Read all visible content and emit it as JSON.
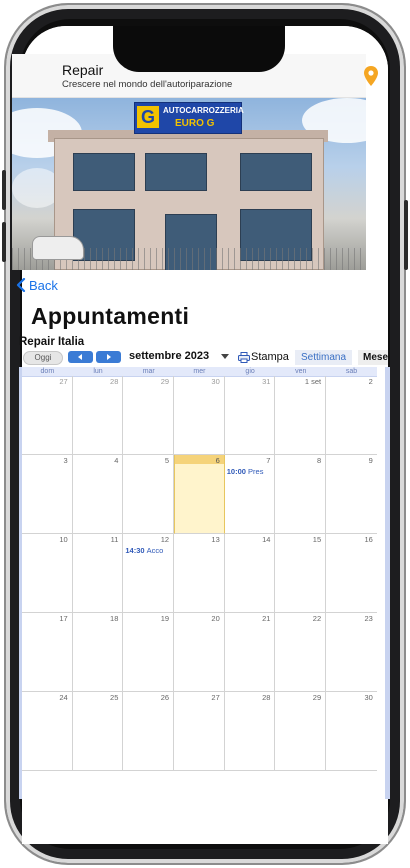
{
  "app": {
    "title": "Repair",
    "subtitle": "Crescere nel mondo dell'autoriparazione",
    "location_icon": "map-pin-icon",
    "accent_color": "#f5a623"
  },
  "banner": {
    "sign_line1": "AUTOCARROZZERIA",
    "sign_line2": "EURO G",
    "sign_logo": "G"
  },
  "nav": {
    "back_label": "Back",
    "back_icon": "chevron-left-icon",
    "page_title": "Appuntamenti"
  },
  "calendar": {
    "name": "Repair Italia",
    "today_label": "Oggi",
    "prev_icon": "arrow-left-icon",
    "next_icon": "arrow-right-icon",
    "month_label": "settembre 2023",
    "print_label": "Stampa",
    "print_icon": "printer-icon",
    "tab_week": "Settimana",
    "tab_month": "Mese",
    "weekdays": [
      "dom",
      "lun",
      "mar",
      "mer",
      "gio",
      "ven",
      "sab"
    ],
    "weeks": [
      [
        {
          "n": "27",
          "other": true
        },
        {
          "n": "28",
          "other": true
        },
        {
          "n": "29",
          "other": true
        },
        {
          "n": "30",
          "other": true
        },
        {
          "n": "31",
          "other": true
        },
        {
          "n": "1 set",
          "other": false
        },
        {
          "n": "2",
          "other": false
        }
      ],
      [
        {
          "n": "3"
        },
        {
          "n": "4"
        },
        {
          "n": "5"
        },
        {
          "n": "6",
          "today": true
        },
        {
          "n": "7",
          "event_time": "10:00",
          "event_text": "Pres"
        },
        {
          "n": "8"
        },
        {
          "n": "9"
        }
      ],
      [
        {
          "n": "10"
        },
        {
          "n": "11"
        },
        {
          "n": "12",
          "event_time": "14:30",
          "event_text": "Acco"
        },
        {
          "n": "13"
        },
        {
          "n": "14"
        },
        {
          "n": "15"
        },
        {
          "n": "16"
        }
      ],
      [
        {
          "n": "17"
        },
        {
          "n": "18"
        },
        {
          "n": "19"
        },
        {
          "n": "20"
        },
        {
          "n": "21"
        },
        {
          "n": "22"
        },
        {
          "n": "23"
        }
      ],
      [
        {
          "n": "24"
        },
        {
          "n": "25"
        },
        {
          "n": "26"
        },
        {
          "n": "27"
        },
        {
          "n": "28"
        },
        {
          "n": "29"
        },
        {
          "n": "30"
        }
      ]
    ]
  }
}
